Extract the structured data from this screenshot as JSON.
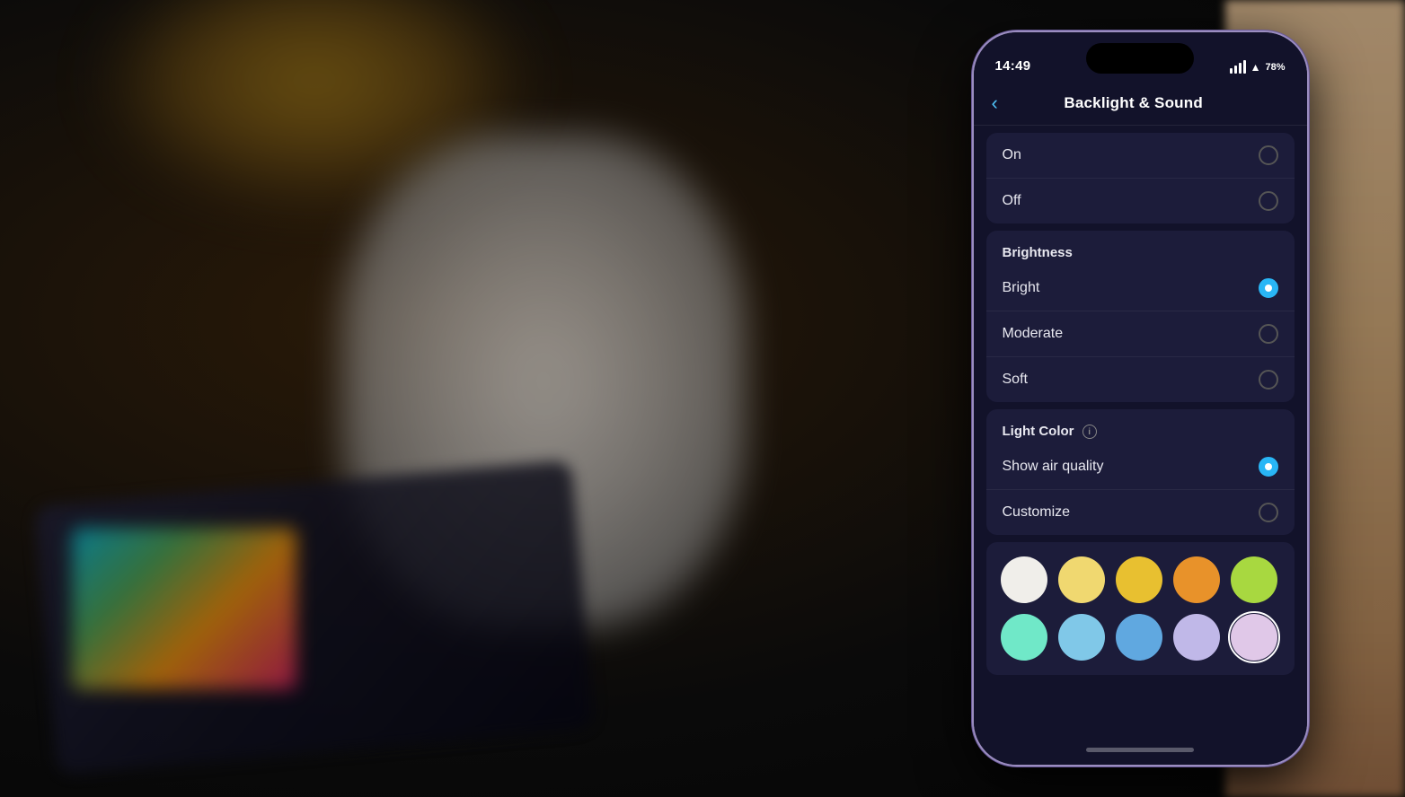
{
  "background": {
    "desc": "Blurred room with lamp, white air purifier, dark device with colorful screen"
  },
  "statusBar": {
    "time": "14:49",
    "signal": "signal",
    "wifi": "wifi",
    "battery": "78"
  },
  "navBar": {
    "back_label": "‹",
    "title": "Backlight & Sound"
  },
  "onOffSection": {
    "rows": [
      {
        "label": "On",
        "selected": false
      },
      {
        "label": "Off",
        "selected": false
      }
    ]
  },
  "brightnessSection": {
    "header": "Brightness",
    "rows": [
      {
        "label": "Bright",
        "selected": true
      },
      {
        "label": "Moderate",
        "selected": false
      },
      {
        "label": "Soft",
        "selected": false
      }
    ]
  },
  "lightColorSection": {
    "header_label": "Light Color",
    "has_info": true,
    "rows": [
      {
        "label": "Show air quality",
        "selected": true
      },
      {
        "label": "Customize",
        "selected": false
      }
    ]
  },
  "colorSwatches": {
    "row1": [
      {
        "id": "white",
        "color": "#f0eeea",
        "selected": false
      },
      {
        "id": "light-yellow",
        "color": "#f0d870",
        "selected": false
      },
      {
        "id": "yellow",
        "color": "#e8c030",
        "selected": false
      },
      {
        "id": "orange",
        "color": "#e8922a",
        "selected": false
      },
      {
        "id": "lime",
        "color": "#a8d840",
        "selected": false
      }
    ],
    "row2": [
      {
        "id": "mint",
        "color": "#70e8c8",
        "selected": false
      },
      {
        "id": "light-blue",
        "color": "#80c8e8",
        "selected": false
      },
      {
        "id": "blue",
        "color": "#60a8e0",
        "selected": false
      },
      {
        "id": "lavender",
        "color": "#c0b8e8",
        "selected": false
      },
      {
        "id": "pink-lavender",
        "color": "#e0c8e8",
        "selected": true
      }
    ]
  },
  "homeIndicator": {
    "desc": "home bar"
  }
}
